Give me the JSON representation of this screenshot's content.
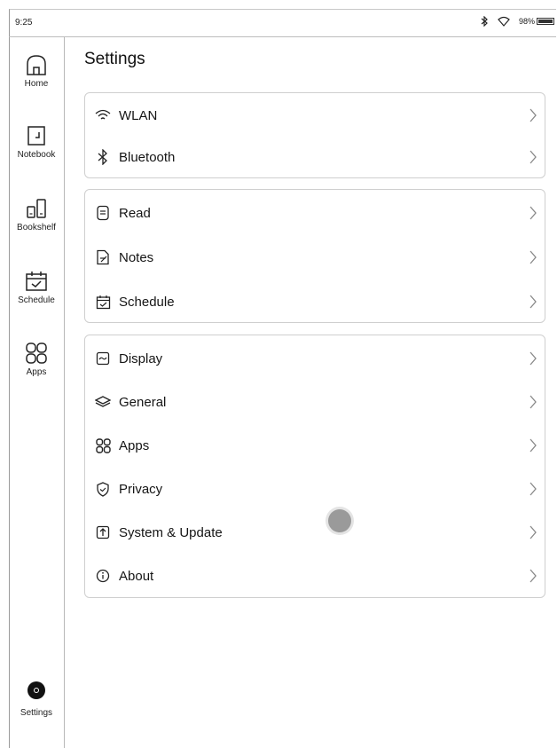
{
  "status": {
    "time": "9:25",
    "battery_text": "98%",
    "battery_level": 0.98,
    "icons": [
      "bluetooth-icon",
      "wifi-icon",
      "battery-icon"
    ]
  },
  "sidebar": {
    "items": [
      {
        "label": "Home",
        "icon": "home-icon"
      },
      {
        "label": "Notebook",
        "icon": "notebook-icon"
      },
      {
        "label": "Bookshelf",
        "icon": "bookshelf-icon"
      },
      {
        "label": "Schedule",
        "icon": "schedule-icon"
      },
      {
        "label": "Apps",
        "icon": "apps-icon"
      }
    ],
    "settings": {
      "label": "Settings",
      "icon": "settings-icon"
    }
  },
  "page": {
    "title": "Settings"
  },
  "groups": [
    {
      "items": [
        {
          "label": "WLAN",
          "icon": "wifi-icon"
        },
        {
          "label": "Bluetooth",
          "icon": "bluetooth-icon"
        }
      ]
    },
    {
      "items": [
        {
          "label": "Read",
          "icon": "read-icon"
        },
        {
          "label": "Notes",
          "icon": "notes-icon"
        },
        {
          "label": "Schedule",
          "icon": "schedule-icon"
        }
      ]
    },
    {
      "items": [
        {
          "label": "Display",
          "icon": "display-icon"
        },
        {
          "label": "General",
          "icon": "layers-icon"
        },
        {
          "label": "Apps",
          "icon": "apps-icon"
        },
        {
          "label": "Privacy",
          "icon": "shield-icon"
        },
        {
          "label": "System & Update",
          "icon": "update-icon"
        },
        {
          "label": "About",
          "icon": "info-icon"
        }
      ]
    }
  ],
  "colors": {
    "border": "#cfcfcf",
    "text": "#151515",
    "accent": "#111111"
  }
}
